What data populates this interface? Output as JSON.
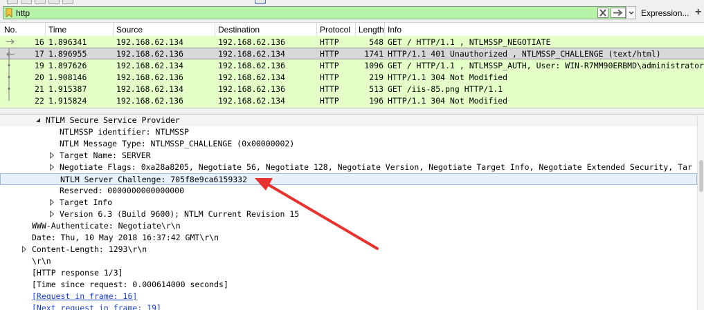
{
  "filter": {
    "value": "http",
    "expression_label": "Expression...",
    "add_label": "+"
  },
  "columns": [
    "No.",
    "Time",
    "Source",
    "Destination",
    "Protocol",
    "Length",
    "Info"
  ],
  "packets": [
    {
      "no": "16",
      "time": "1.896341",
      "src": "192.168.62.134",
      "dst": "192.168.62.136",
      "proto": "HTTP",
      "len": "548",
      "info": "GET / HTTP/1.1 , NTLMSSP_NEGOTIATE",
      "mark": "request"
    },
    {
      "no": "17",
      "time": "1.896955",
      "src": "192.168.62.136",
      "dst": "192.168.62.134",
      "proto": "HTTP",
      "len": "1741",
      "info": "HTTP/1.1 401 Unauthorized , NTLMSSP_CHALLENGE (text/html)",
      "mark": "response",
      "selected": true
    },
    {
      "no": "19",
      "time": "1.897626",
      "src": "192.168.62.134",
      "dst": "192.168.62.136",
      "proto": "HTTP",
      "len": "1096",
      "info": "GET / HTTP/1.1 , NTLMSSP_AUTH, User: WIN-R7MM90ERBMD\\administrator",
      "mark": "line"
    },
    {
      "no": "20",
      "time": "1.908146",
      "src": "192.168.62.136",
      "dst": "192.168.62.134",
      "proto": "HTTP",
      "len": "219",
      "info": "HTTP/1.1 304 Not Modified",
      "mark": "line"
    },
    {
      "no": "21",
      "time": "1.915387",
      "src": "192.168.62.134",
      "dst": "192.168.62.136",
      "proto": "HTTP",
      "len": "513",
      "info": "GET /iis-85.png HTTP/1.1",
      "mark": "line"
    },
    {
      "no": "22",
      "time": "1.915824",
      "src": "192.168.62.136",
      "dst": "192.168.62.134",
      "proto": "HTTP",
      "len": "196",
      "info": "HTTP/1.1 304 Not Modified",
      "mark": "end"
    }
  ],
  "details": [
    {
      "text": "NTLM Secure Service Provider",
      "indent": 66,
      "expander": "open"
    },
    {
      "text": "NTLMSSP identifier: NTLMSSP",
      "indent": 86,
      "expander": "none"
    },
    {
      "text": "NTLM Message Type: NTLMSSP_CHALLENGE (0x00000002)",
      "indent": 86,
      "expander": "none"
    },
    {
      "text": "Target Name: SERVER",
      "indent": 86,
      "expander": "closed"
    },
    {
      "text": "Negotiate Flags: 0xa28a8205, Negotiate 56, Negotiate 128, Negotiate Version, Negotiate Target Info, Negotiate Extended Security, Tar",
      "indent": 86,
      "expander": "closed"
    },
    {
      "text": "NTLM Server Challenge: 705f8e9ca6159332",
      "indent": 86,
      "expander": "none",
      "highlight": true
    },
    {
      "text": "Reserved: 0000000000000000",
      "indent": 86,
      "expander": "none"
    },
    {
      "text": "Target Info",
      "indent": 86,
      "expander": "closed"
    },
    {
      "text": "Version 6.3 (Build 9600); NTLM Current Revision 15",
      "indent": 86,
      "expander": "closed"
    },
    {
      "text": "WWW-Authenticate: Negotiate\\r\\n",
      "indent": 46,
      "expander": "none"
    },
    {
      "text": "Date: Thu, 10 May 2018 16:37:42 GMT\\r\\n",
      "indent": 46,
      "expander": "none"
    },
    {
      "text": "Content-Length: 1293\\r\\n",
      "indent": 46,
      "expander": "closed"
    },
    {
      "text": "\\r\\n",
      "indent": 46,
      "expander": "none"
    },
    {
      "text": "[HTTP response 1/3]",
      "indent": 46,
      "expander": "none"
    },
    {
      "text": "[Time since request: 0.000614000 seconds]",
      "indent": 46,
      "expander": "none"
    },
    {
      "text": "[Request in frame: 16]",
      "indent": 46,
      "expander": "none",
      "link": true
    },
    {
      "text": "[Next request in frame: 19]",
      "indent": 46,
      "expander": "none",
      "link": true
    }
  ],
  "colors": {
    "filter_bg": "#b5f3a8",
    "packet_bg": "#e4ffc7",
    "selected_bg": "#d8d8d8",
    "highlight_bg": "#e7f0fb",
    "arrow": "#e8322d",
    "link": "#1a3fd0"
  },
  "icons": {
    "bookmark": "bookmark-icon",
    "clear": "clear-x-icon",
    "apply": "apply-arrow-icon",
    "dropdown": "chevron-down-icon",
    "arrow": "red-arrow-annotation"
  }
}
